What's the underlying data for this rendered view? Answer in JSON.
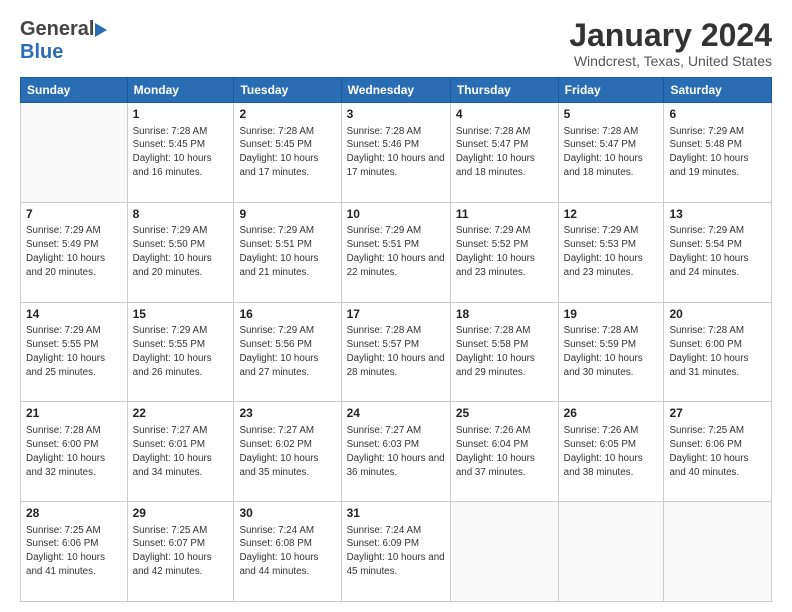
{
  "header": {
    "logo_general": "General",
    "logo_blue": "Blue",
    "month_title": "January 2024",
    "location": "Windcrest, Texas, United States"
  },
  "weekdays": [
    "Sunday",
    "Monday",
    "Tuesday",
    "Wednesday",
    "Thursday",
    "Friday",
    "Saturday"
  ],
  "weeks": [
    [
      {
        "day": "",
        "info": ""
      },
      {
        "day": "1",
        "info": "Sunrise: 7:28 AM\nSunset: 5:45 PM\nDaylight: 10 hours\nand 16 minutes."
      },
      {
        "day": "2",
        "info": "Sunrise: 7:28 AM\nSunset: 5:45 PM\nDaylight: 10 hours\nand 17 minutes."
      },
      {
        "day": "3",
        "info": "Sunrise: 7:28 AM\nSunset: 5:46 PM\nDaylight: 10 hours\nand 17 minutes."
      },
      {
        "day": "4",
        "info": "Sunrise: 7:28 AM\nSunset: 5:47 PM\nDaylight: 10 hours\nand 18 minutes."
      },
      {
        "day": "5",
        "info": "Sunrise: 7:28 AM\nSunset: 5:47 PM\nDaylight: 10 hours\nand 18 minutes."
      },
      {
        "day": "6",
        "info": "Sunrise: 7:29 AM\nSunset: 5:48 PM\nDaylight: 10 hours\nand 19 minutes."
      }
    ],
    [
      {
        "day": "7",
        "info": "Sunrise: 7:29 AM\nSunset: 5:49 PM\nDaylight: 10 hours\nand 20 minutes."
      },
      {
        "day": "8",
        "info": "Sunrise: 7:29 AM\nSunset: 5:50 PM\nDaylight: 10 hours\nand 20 minutes."
      },
      {
        "day": "9",
        "info": "Sunrise: 7:29 AM\nSunset: 5:51 PM\nDaylight: 10 hours\nand 21 minutes."
      },
      {
        "day": "10",
        "info": "Sunrise: 7:29 AM\nSunset: 5:51 PM\nDaylight: 10 hours\nand 22 minutes."
      },
      {
        "day": "11",
        "info": "Sunrise: 7:29 AM\nSunset: 5:52 PM\nDaylight: 10 hours\nand 23 minutes."
      },
      {
        "day": "12",
        "info": "Sunrise: 7:29 AM\nSunset: 5:53 PM\nDaylight: 10 hours\nand 23 minutes."
      },
      {
        "day": "13",
        "info": "Sunrise: 7:29 AM\nSunset: 5:54 PM\nDaylight: 10 hours\nand 24 minutes."
      }
    ],
    [
      {
        "day": "14",
        "info": "Sunrise: 7:29 AM\nSunset: 5:55 PM\nDaylight: 10 hours\nand 25 minutes."
      },
      {
        "day": "15",
        "info": "Sunrise: 7:29 AM\nSunset: 5:55 PM\nDaylight: 10 hours\nand 26 minutes."
      },
      {
        "day": "16",
        "info": "Sunrise: 7:29 AM\nSunset: 5:56 PM\nDaylight: 10 hours\nand 27 minutes."
      },
      {
        "day": "17",
        "info": "Sunrise: 7:28 AM\nSunset: 5:57 PM\nDaylight: 10 hours\nand 28 minutes."
      },
      {
        "day": "18",
        "info": "Sunrise: 7:28 AM\nSunset: 5:58 PM\nDaylight: 10 hours\nand 29 minutes."
      },
      {
        "day": "19",
        "info": "Sunrise: 7:28 AM\nSunset: 5:59 PM\nDaylight: 10 hours\nand 30 minutes."
      },
      {
        "day": "20",
        "info": "Sunrise: 7:28 AM\nSunset: 6:00 PM\nDaylight: 10 hours\nand 31 minutes."
      }
    ],
    [
      {
        "day": "21",
        "info": "Sunrise: 7:28 AM\nSunset: 6:00 PM\nDaylight: 10 hours\nand 32 minutes."
      },
      {
        "day": "22",
        "info": "Sunrise: 7:27 AM\nSunset: 6:01 PM\nDaylight: 10 hours\nand 34 minutes."
      },
      {
        "day": "23",
        "info": "Sunrise: 7:27 AM\nSunset: 6:02 PM\nDaylight: 10 hours\nand 35 minutes."
      },
      {
        "day": "24",
        "info": "Sunrise: 7:27 AM\nSunset: 6:03 PM\nDaylight: 10 hours\nand 36 minutes."
      },
      {
        "day": "25",
        "info": "Sunrise: 7:26 AM\nSunset: 6:04 PM\nDaylight: 10 hours\nand 37 minutes."
      },
      {
        "day": "26",
        "info": "Sunrise: 7:26 AM\nSunset: 6:05 PM\nDaylight: 10 hours\nand 38 minutes."
      },
      {
        "day": "27",
        "info": "Sunrise: 7:25 AM\nSunset: 6:06 PM\nDaylight: 10 hours\nand 40 minutes."
      }
    ],
    [
      {
        "day": "28",
        "info": "Sunrise: 7:25 AM\nSunset: 6:06 PM\nDaylight: 10 hours\nand 41 minutes."
      },
      {
        "day": "29",
        "info": "Sunrise: 7:25 AM\nSunset: 6:07 PM\nDaylight: 10 hours\nand 42 minutes."
      },
      {
        "day": "30",
        "info": "Sunrise: 7:24 AM\nSunset: 6:08 PM\nDaylight: 10 hours\nand 44 minutes."
      },
      {
        "day": "31",
        "info": "Sunrise: 7:24 AM\nSunset: 6:09 PM\nDaylight: 10 hours\nand 45 minutes."
      },
      {
        "day": "",
        "info": ""
      },
      {
        "day": "",
        "info": ""
      },
      {
        "day": "",
        "info": ""
      }
    ]
  ]
}
